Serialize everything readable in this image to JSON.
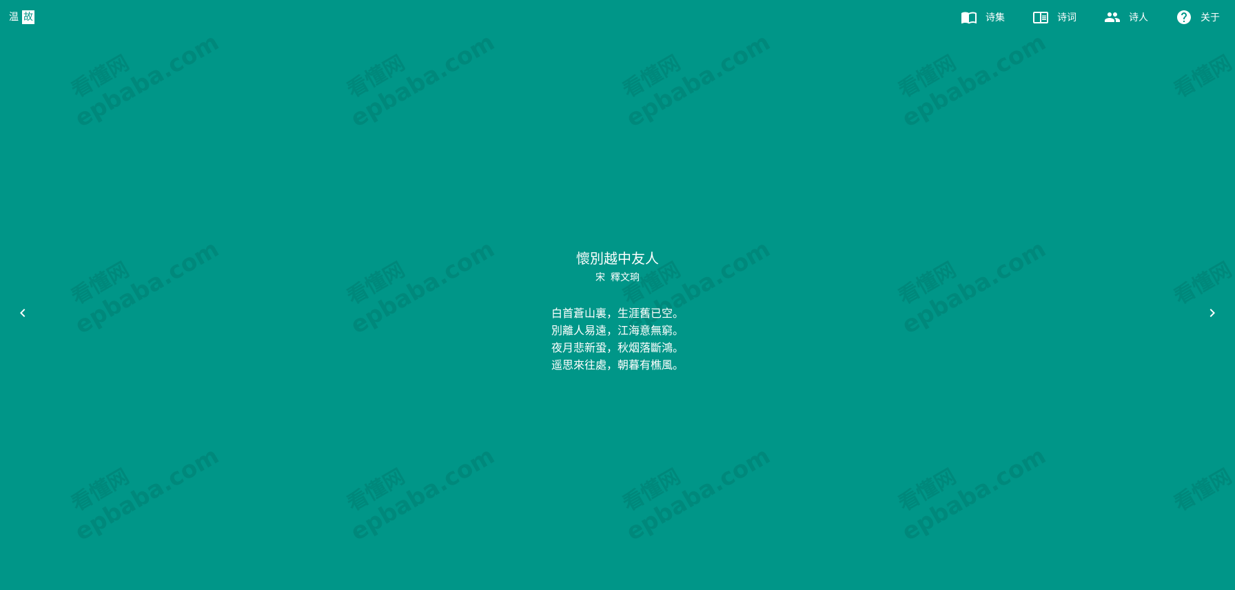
{
  "logo": {
    "part1": "温",
    "part2": "故"
  },
  "nav": [
    {
      "icon": "open-book-icon",
      "label": "诗集"
    },
    {
      "icon": "book-text-icon",
      "label": "诗词"
    },
    {
      "icon": "people-icon",
      "label": "诗人"
    },
    {
      "icon": "help-circle-icon",
      "label": "关于"
    }
  ],
  "poem": {
    "title": "懷別越中友人",
    "dynasty": "宋",
    "author": "釋文珦",
    "lines": [
      "白首蒼山裏，生涯舊已空。",
      "別離人易遠，江海意無窮。",
      "夜月悲新蛩，秋烟落斷鴻。",
      "遥思來往處，朝暮有樵風。"
    ]
  },
  "watermark": {
    "cn": "看懂网",
    "en": "epbaba.com"
  },
  "controls": {
    "prev_icon": "chevron-left-icon",
    "next_icon": "chevron-right-icon"
  },
  "colors": {
    "background": "#009688",
    "text": "#ffffff"
  }
}
